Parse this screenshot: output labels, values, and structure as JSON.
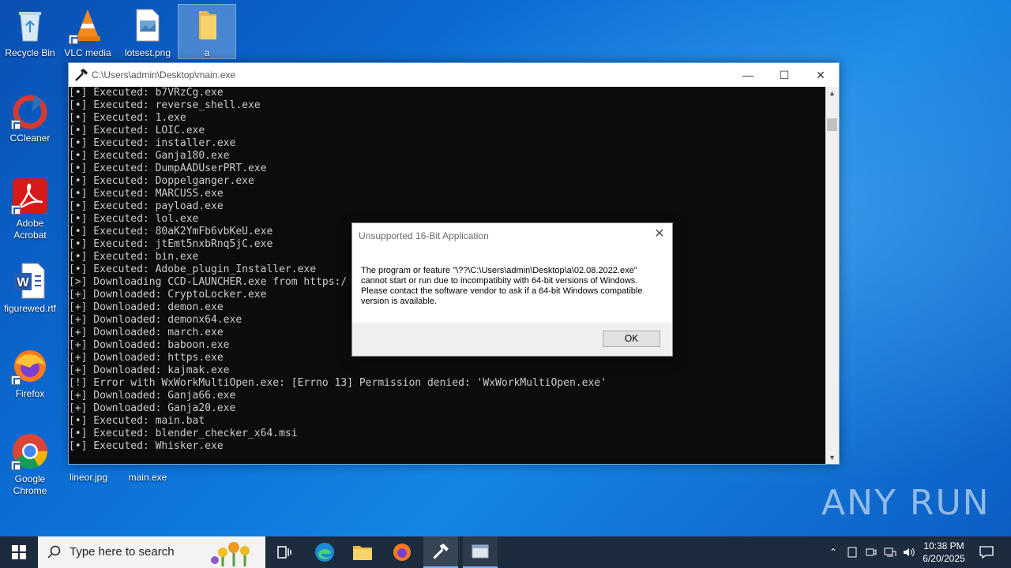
{
  "desktop": {
    "icons": [
      {
        "label": "Recycle Bin"
      },
      {
        "label": "VLC media"
      },
      {
        "label": "lotsest.png"
      },
      {
        "label": "a"
      },
      {
        "label": "CCleaner"
      },
      {
        "label": "Adobe Acrobat"
      },
      {
        "label": "figurewed.rtf"
      },
      {
        "label": "Firefox"
      },
      {
        "label": "Google Chrome"
      },
      {
        "label": "lineor.jpg"
      },
      {
        "label": "main.exe"
      }
    ],
    "watermark": "ANY RUN"
  },
  "console": {
    "title": "C:\\Users\\admin\\Desktop\\main.exe",
    "lines": [
      "[•] Executed: b7VRzCg.exe",
      "[•] Executed: reverse_shell.exe",
      "[•] Executed: 1.exe",
      "[•] Executed: LOIC.exe",
      "[•] Executed: installer.exe",
      "[•] Executed: Ganja180.exe",
      "[•] Executed: DumpAADUserPRT.exe",
      "[•] Executed: Doppelganger.exe",
      "[•] Executed: MARCUSS.exe",
      "[•] Executed: payload.exe",
      "[•] Executed: lol.exe",
      "[•] Executed: 80aK2YmFb6vbKeU.exe",
      "[•] Executed: jtEmt5nxbRnq5jC.exe",
      "[•] Executed: bin.exe",
      "[•] Executed: Adobe_plugin_Installer.exe",
      "[>] Downloading CCD-LAUNCHER.exe from https:/",
      "[+] Downloaded: CryptoLocker.exe",
      "[+] Downloaded: demon.exe",
      "[+] Downloaded: demonx64.exe",
      "[+] Downloaded: march.exe",
      "[+] Downloaded: baboon.exe",
      "[+] Downloaded: https.exe",
      "[+] Downloaded: kajmak.exe",
      "[!] Error with WxWorkMultiOpen.exe: [Errno 13] Permission denied: 'WxWorkMultiOpen.exe'",
      "[+] Downloaded: Ganja66.exe",
      "[+] Downloaded: Ganja20.exe",
      "[•] Executed: main.bat",
      "[•] Executed: blender_checker_x64.msi",
      "[•] Executed: Whisker.exe"
    ]
  },
  "dialog": {
    "title": "Unsupported 16-Bit Application",
    "message": "The program or feature \"\\??\\C:\\Users\\admin\\Desktop\\a\\02.08.2022.exe\" cannot start or run due to incompatibity with 64-bit versions of Windows. Please contact the software vendor to ask if a 64-bit Windows compatible version is available.",
    "ok_label": "OK"
  },
  "taskbar": {
    "search_placeholder": "Type here to search",
    "time": "10:38 PM",
    "date": "6/20/2025"
  }
}
